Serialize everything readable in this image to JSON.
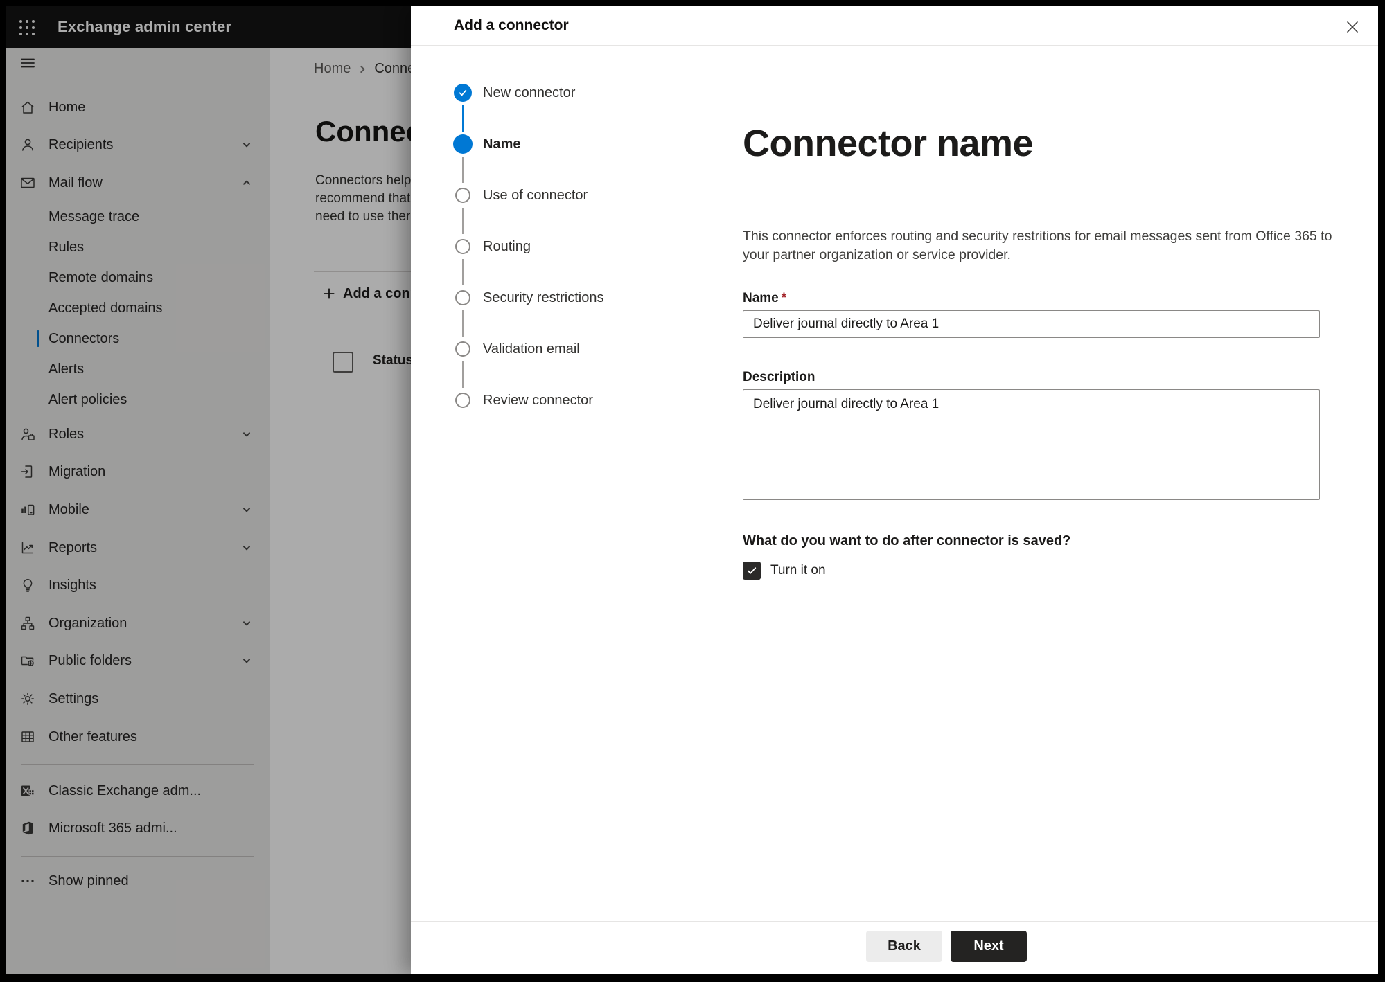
{
  "app": {
    "title": "Exchange admin center"
  },
  "colors": {
    "accent_blue": "#0078d4",
    "required_red": "#a4262c",
    "checkbox_bg": "#2b2a29",
    "next_button_bg": "#242322",
    "back_button_bg": "#ececec"
  },
  "sidebar": {
    "items": [
      {
        "label": "Home",
        "icon": "home"
      },
      {
        "label": "Recipients",
        "icon": "person",
        "chevron": "down"
      },
      {
        "label": "Mail flow",
        "icon": "mail",
        "chevron": "up"
      },
      {
        "label": "Message trace",
        "sub": true
      },
      {
        "label": "Rules",
        "sub": true
      },
      {
        "label": "Remote domains",
        "sub": true
      },
      {
        "label": "Accepted domains",
        "sub": true
      },
      {
        "label": "Connectors",
        "sub": true,
        "selected": true
      },
      {
        "label": "Alerts",
        "sub": true
      },
      {
        "label": "Alert policies",
        "sub": true
      },
      {
        "label": "Roles",
        "icon": "roles",
        "chevron": "down"
      },
      {
        "label": "Migration",
        "icon": "migration"
      },
      {
        "label": "Mobile",
        "icon": "mobile",
        "chevron": "down"
      },
      {
        "label": "Reports",
        "icon": "reports",
        "chevron": "down"
      },
      {
        "label": "Insights",
        "icon": "insights"
      },
      {
        "label": "Organization",
        "icon": "org",
        "chevron": "down"
      },
      {
        "label": "Public folders",
        "icon": "folders",
        "chevron": "down"
      },
      {
        "label": "Settings",
        "icon": "settings"
      },
      {
        "label": "Other features",
        "icon": "grid"
      }
    ],
    "footer_items": [
      {
        "label": "Classic Exchange adm...",
        "icon": "exchange"
      },
      {
        "label": "Microsoft 365 admi...",
        "icon": "office"
      }
    ],
    "show_pinned": "Show pinned"
  },
  "page": {
    "breadcrumb": {
      "home": "Home",
      "current": "Conne"
    },
    "title_fragment": "Connec",
    "intro_lines": [
      "Connectors help",
      "recommend that",
      "need to use ther"
    ],
    "add_button": "Add a conn",
    "table": {
      "status_header": "Status"
    }
  },
  "dialog": {
    "title": "Add a connector",
    "steps": [
      {
        "label": "New connector",
        "state": "completed"
      },
      {
        "label": "Name",
        "state": "current"
      },
      {
        "label": "Use of connector",
        "state": "upcoming"
      },
      {
        "label": "Routing",
        "state": "upcoming"
      },
      {
        "label": "Security restrictions",
        "state": "upcoming"
      },
      {
        "label": "Validation email",
        "state": "upcoming"
      },
      {
        "label": "Review connector",
        "state": "upcoming"
      }
    ],
    "content": {
      "heading": "Connector name",
      "intro": "This connector enforces routing and security restritions for email messages sent from Office 365 to your partner organization or service provider.",
      "name_label": "Name",
      "required_marker": "*",
      "name_value": "Deliver journal directly to Area 1",
      "description_label": "Description",
      "description_value": "Deliver journal directly to Area 1",
      "after_save_question": "What do you want to do after connector is saved?",
      "turn_on_label": "Turn it on",
      "turn_on_checked": true
    },
    "footer": {
      "back_label": "Back",
      "next_label": "Next"
    }
  }
}
